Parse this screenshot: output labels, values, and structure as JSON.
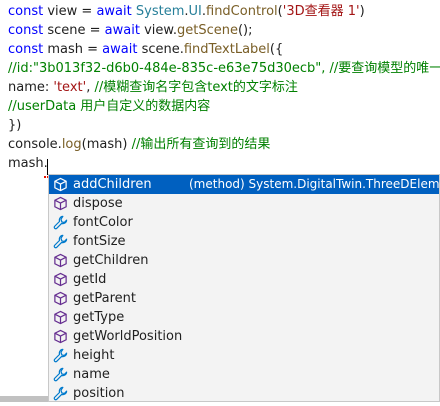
{
  "code": {
    "line1": {
      "kw1": "const",
      "t1": " view = ",
      "kw2": "await",
      "t2": " ",
      "ty1": "System",
      "t3": ".",
      "ty2": "UI",
      "t4": ".",
      "fn1": "findControl",
      "t5": "(",
      "st1": "'3D查看器 1'",
      "t6": ")"
    },
    "line2": {
      "kw1": "const",
      "t1": " scene = ",
      "kw2": "await",
      "t2": " view.",
      "fn1": "getScene",
      "t3": "();"
    },
    "line3": {
      "kw1": "const",
      "t1": " mash = ",
      "kw2": "await",
      "t2": " scene.",
      "fn1": "findTextLabel",
      "t3": "({"
    },
    "line4": {
      "cm1": "//id:\"3b013f32-d6b0-484e-835c-e63e75d30ecb\", //要查询模型的唯一"
    },
    "line5": {
      "t1": "name: ",
      "st1": "'text'",
      "t2": ", ",
      "cm1": "//模糊查询名字包含text的文字标注"
    },
    "line6": {
      "cm1": "//userData  用户自定义的数据内容"
    },
    "line7": {
      "t1": "})"
    },
    "line8": {
      "t1": "console.",
      "fn1": "log",
      "t2": "(mash) ",
      "cm1": "//输出所有查询到的结果"
    },
    "line9": {
      "t1": "mash."
    }
  },
  "suggestions": [
    {
      "label": "addChildren",
      "kind": "method",
      "detail": "(method) System.DigitalTwin.ThreeDElement."
    },
    {
      "label": "dispose",
      "kind": "method"
    },
    {
      "label": "fontColor",
      "kind": "property"
    },
    {
      "label": "fontSize",
      "kind": "property"
    },
    {
      "label": "getChildren",
      "kind": "method"
    },
    {
      "label": "getId",
      "kind": "method"
    },
    {
      "label": "getParent",
      "kind": "method"
    },
    {
      "label": "getType",
      "kind": "method"
    },
    {
      "label": "getWorldPosition",
      "kind": "method"
    },
    {
      "label": "height",
      "kind": "property"
    },
    {
      "label": "name",
      "kind": "property"
    },
    {
      "label": "position",
      "kind": "property"
    }
  ],
  "icons": {
    "method": "cube-icon",
    "property": "wrench-icon"
  },
  "colors": {
    "keyword": "#0000ff",
    "type": "#267f99",
    "string": "#a31515",
    "comment": "#008000",
    "function": "#795e26",
    "selection": "#0060c0",
    "method_icon": "#652d90",
    "property_icon": "#007acc"
  }
}
